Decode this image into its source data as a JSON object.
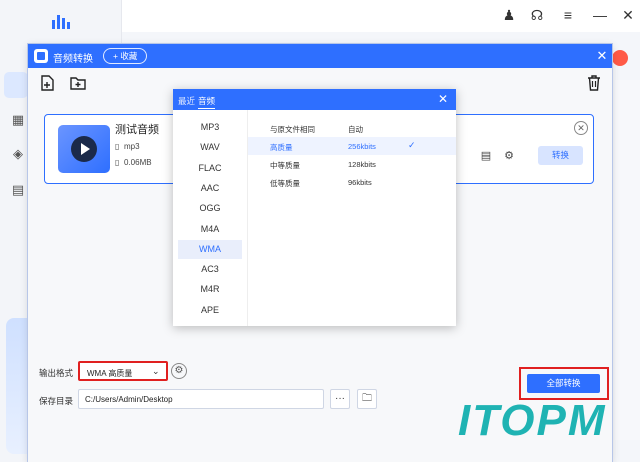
{
  "dialog": {
    "title": "音频转换",
    "favorite_label": "+ 收藏",
    "close_glyph": "✕"
  },
  "file": {
    "name": "测试音频",
    "format": "mp3",
    "size": "0.06MB",
    "convert_label": "转换"
  },
  "format_panel": {
    "tab_recent": "最近",
    "tab_audio": "音频",
    "formats": [
      "MP3",
      "WAV",
      "FLAC",
      "AAC",
      "OGG",
      "M4A",
      "WMA",
      "AC3",
      "M4R",
      "APE"
    ],
    "selected_format": "WMA",
    "quality_rows": [
      {
        "name": "与原文件相同",
        "value": "自动",
        "selected": false
      },
      {
        "name": "高质量",
        "value": "256kbits",
        "selected": true
      },
      {
        "name": "中等质量",
        "value": "128kbits",
        "selected": false
      },
      {
        "name": "低等质量",
        "value": "96kbits",
        "selected": false
      }
    ]
  },
  "bottom": {
    "output_format_label": "输出格式",
    "output_format_value": "WMA 高质量",
    "save_dir_label": "保存目录",
    "save_dir_value": "C:/Users/Admin/Desktop",
    "more_glyph": "···",
    "convert_all_label": "全部转换"
  },
  "watermark": "ITOPM",
  "colors": {
    "accent": "#2e6fff",
    "highlight_border": "#e02020",
    "watermark": "#1fb3b3"
  }
}
